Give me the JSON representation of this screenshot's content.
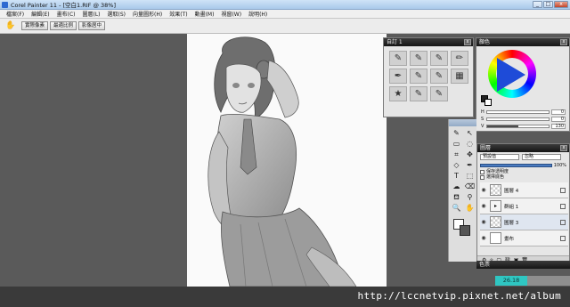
{
  "window": {
    "title": "Corel Painter 11 - [空白1.RIF @ 38%]",
    "minimize_glyph": "_",
    "maximize_glyph": "□",
    "close_glyph": "x"
  },
  "menu": [
    "檔案(F)",
    "編輯(E)",
    "畫布(C)",
    "圖層(L)",
    "選取(S)",
    "向量圖形(H)",
    "效果(T)",
    "動畫(M)",
    "視窗(W)",
    "說明(H)"
  ],
  "property_bar": {
    "hand_icon": "grabber-hand-icon",
    "buttons": [
      "實際像素",
      "最適比例",
      "影像居中"
    ]
  },
  "custom_palette": {
    "title": "自訂 1",
    "brushes": [
      {
        "icon": "brush-icon",
        "glyph": "✎"
      },
      {
        "icon": "brush-icon",
        "glyph": "✎"
      },
      {
        "icon": "brush-icon",
        "glyph": "✎"
      },
      {
        "icon": "pencil-icon",
        "glyph": "✏"
      },
      {
        "icon": "pen-icon",
        "glyph": "✒"
      },
      {
        "icon": "airbrush-icon",
        "glyph": "✎"
      },
      {
        "icon": "marker-icon",
        "glyph": "✎"
      },
      {
        "icon": "sponge-icon",
        "glyph": "▦"
      },
      {
        "icon": "sparkle-icon",
        "glyph": "★"
      },
      {
        "icon": "blender-icon",
        "glyph": "✎"
      },
      {
        "icon": "eraser-icon",
        "glyph": "✎"
      }
    ]
  },
  "colors_panel": {
    "title": "顏色",
    "sliders": [
      {
        "label": "H",
        "value": "0",
        "fraction": 0.0
      },
      {
        "label": "S",
        "value": "0",
        "fraction": 0.0
      },
      {
        "label": "V",
        "value": "130",
        "fraction": 0.51
      }
    ]
  },
  "toolbox": {
    "tools": [
      {
        "icon": "brush-tool-icon",
        "glyph": "✎"
      },
      {
        "icon": "arrow-tool-icon",
        "glyph": "↖"
      },
      {
        "icon": "rect-select-icon",
        "glyph": "▭"
      },
      {
        "icon": "lasso-icon",
        "glyph": "◌"
      },
      {
        "icon": "crop-icon",
        "glyph": "⌗"
      },
      {
        "icon": "move-icon",
        "glyph": "✥"
      },
      {
        "icon": "shape-icon",
        "glyph": "◇"
      },
      {
        "icon": "pen-tool-icon",
        "glyph": "✒"
      },
      {
        "icon": "text-tool-icon",
        "glyph": "T"
      },
      {
        "icon": "shape-select-icon",
        "glyph": "⬚"
      },
      {
        "icon": "blender-tool-icon",
        "glyph": "☁"
      },
      {
        "icon": "eraser-tool-icon",
        "glyph": "⌫"
      },
      {
        "icon": "paint-bucket-icon",
        "glyph": "⛾"
      },
      {
        "icon": "eyedropper-icon",
        "glyph": "⚲"
      },
      {
        "icon": "magnifier-icon",
        "glyph": "🔍"
      },
      {
        "icon": "grabber-icon",
        "glyph": "✋"
      }
    ]
  },
  "layers_panel": {
    "title": "圖層",
    "composite_method": "預設值",
    "composite_depth": "忽略",
    "opacity": "100%",
    "opacity_fraction": 1.0,
    "preserve_transparency": "保存透明度",
    "pick_up_color": "選擇底色",
    "layers": [
      {
        "name": "圖層 4",
        "thumb": "checker",
        "active": false
      },
      {
        "name": "群組 1",
        "thumb": "group",
        "active": false
      },
      {
        "name": "圖層 3",
        "thumb": "checker",
        "active": true
      },
      {
        "name": "畫布",
        "thumb": "plain",
        "active": false
      }
    ]
  },
  "color_set": {
    "title": "色票"
  },
  "status": {
    "value": "26.18"
  },
  "watermark": "http://lccnetvip.pixnet.net/album"
}
